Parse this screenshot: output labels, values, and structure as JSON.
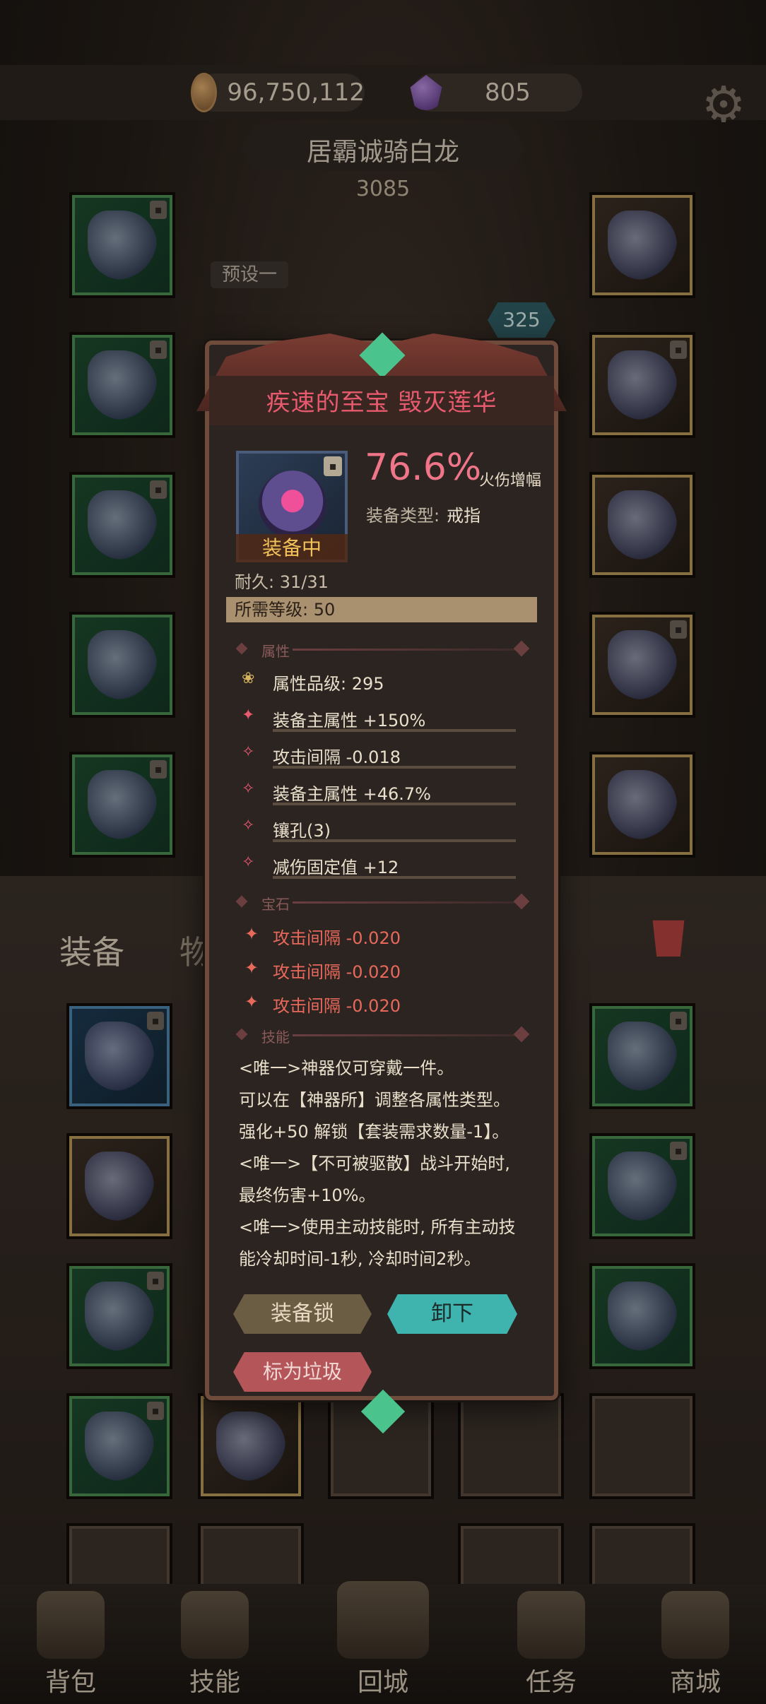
{
  "currency": {
    "gold": "96,750,112",
    "gems": "805"
  },
  "hero": {
    "name": "居霸诚骑白龙",
    "power": "3085",
    "preset": "预设一",
    "level_badge": "325"
  },
  "tabs": {
    "equipment": "装备",
    "items": "物品"
  },
  "popup": {
    "title": "疾速的至宝 毁灭莲华",
    "main_value": "76.6%",
    "main_label": "火伤增幅",
    "equip_type_label": "装备类型:",
    "equip_type": "戒指",
    "status": "装备中",
    "durability": "耐久: 31/31",
    "required_level": "所需等级: 50",
    "sections": {
      "attributes": "属性",
      "gems": "宝石",
      "skills": "技能"
    },
    "attributes": [
      "属性品级: 295",
      "装备主属性 +150%",
      "攻击间隔 -0.018",
      "装备主属性 +46.7%",
      "镶孔(3)",
      "减伤固定值 +12"
    ],
    "gems": [
      "攻击间隔 -0.020",
      "攻击间隔 -0.020",
      "攻击间隔 -0.020"
    ],
    "skill_text": "<唯一>神器仅可穿戴一件。\n可以在【神器所】调整各属性类型。\n强化+50 解锁【套装需求数量-1】。\n<唯一>【不可被驱散】战斗开始时,\n最终伤害+10%。\n<唯一>使用主动技能时, 所有主动技\n能冷却时间-1秒, 冷却时间2秒。",
    "buttons": {
      "lock": "装备锁",
      "unequip": "卸下",
      "mark_junk": "标为垃圾"
    }
  },
  "nav": [
    "背包",
    "技能",
    "回城",
    "任务",
    "商城"
  ],
  "colors": {
    "title": "#e85a6e",
    "gem_text": "#e8695b",
    "unequip_btn": "#3fb3ad"
  }
}
